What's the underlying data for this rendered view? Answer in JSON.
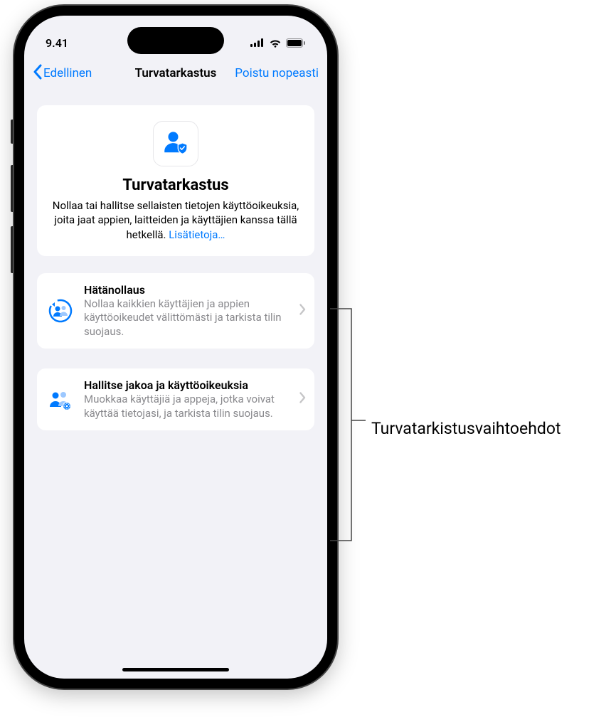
{
  "status": {
    "time": "9.41"
  },
  "nav": {
    "back": "Edellinen",
    "title": "Turvatarkastus",
    "exit": "Poistu nopeasti"
  },
  "intro": {
    "title": "Turvatarkastus",
    "body": "Nollaa tai hallitse sellaisten tietojen käyttöoikeuksia, joita jaat appien, laitteiden ja käyttäjien kanssa tällä hetkellä. ",
    "link": "Lisätietoja…"
  },
  "options": [
    {
      "title": "Hätänollaus",
      "desc": "Nollaa kaikkien käyttäjien ja appien käyttöoikeudet välittömästi ja tarkista tilin suojaus."
    },
    {
      "title": "Hallitse jakoa ja käyttöoikeuksia",
      "desc": "Muokkaa käyttäjiä ja appeja, jotka voivat käyttää tietojasi, ja tarkista tilin suojaus."
    }
  ],
  "annotation": {
    "label": "Turvatarkistusvaihtoehdot"
  }
}
